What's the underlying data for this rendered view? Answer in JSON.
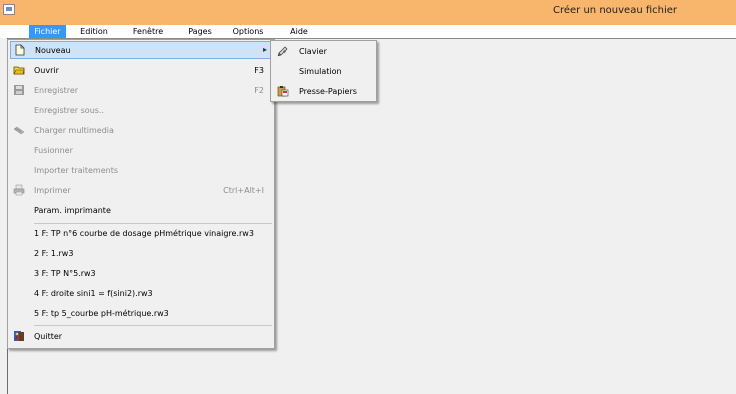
{
  "window": {
    "title": "Créer un nouveau fichier"
  },
  "menubar": [
    "Fichier",
    "Edition",
    "Fenêtre",
    "Pages",
    "Options",
    "Aide"
  ],
  "menu": {
    "items": [
      {
        "label": "Nouveau",
        "shortcut": "",
        "icon": "new-file-icon"
      },
      {
        "label": "Ouvrir",
        "shortcut": "F3",
        "icon": "open-folder-icon"
      },
      {
        "label": "Enregistrer",
        "shortcut": "F2",
        "icon": "save-icon"
      },
      {
        "label": "Enregistrer sous..",
        "shortcut": ""
      },
      {
        "label": "Charger multimedia",
        "shortcut": "",
        "icon": "multimedia-icon"
      },
      {
        "label": "Fusionner",
        "shortcut": ""
      },
      {
        "label": "Importer traitements",
        "shortcut": ""
      },
      {
        "label": "Imprimer",
        "shortcut": "Ctrl+Alt+I",
        "icon": "printer-icon"
      },
      {
        "label": "Param. imprimante",
        "shortcut": ""
      }
    ],
    "recent": [
      "1 F: TP n°6 courbe de dosage pHmétrique vinaigre.rw3",
      "2 F: 1.rw3",
      "3 F: TP N°5.rw3",
      "4 F: droite sini1 = f(sini2).rw3",
      "5 F: tp 5_courbe pH-métrique.rw3"
    ],
    "quit": "Quitter"
  },
  "submenu": [
    "Clavier",
    "Simulation",
    "Presse-Papiers"
  ],
  "colors": {
    "titlebar": "#f8b56c",
    "menu_active": "#3399ff",
    "highlight": "#cfe3f7"
  }
}
